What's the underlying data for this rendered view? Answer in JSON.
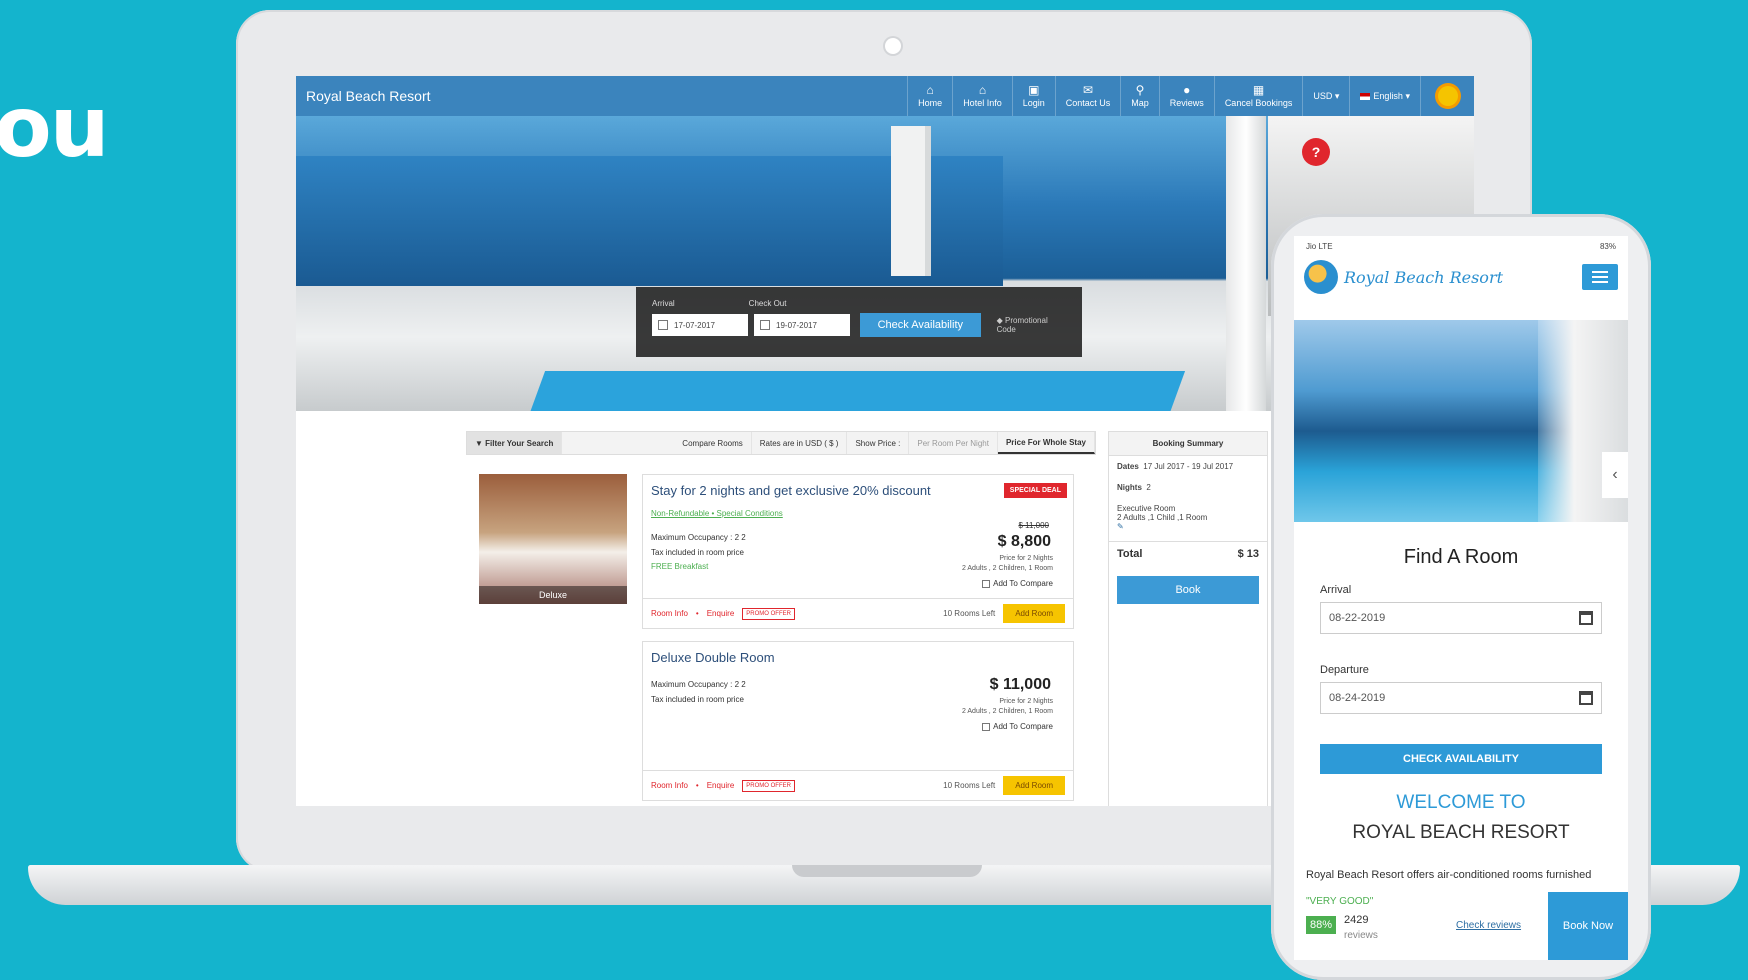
{
  "headline": "ou",
  "desktop": {
    "brand": "Royal Beach Resort",
    "nav": [
      {
        "icon": "home-icon",
        "glyph": "⌂",
        "label": "Home"
      },
      {
        "icon": "hotel-info-icon",
        "glyph": "⌂",
        "label": "Hotel Info"
      },
      {
        "icon": "lock-icon",
        "glyph": "🔒",
        "label": "Login"
      },
      {
        "icon": "envelope-icon",
        "glyph": "✉",
        "label": "Contact Us"
      },
      {
        "icon": "map-pin-icon",
        "glyph": "⚲",
        "label": "Map"
      },
      {
        "icon": "chat-icon",
        "glyph": "💬",
        "label": "Reviews"
      },
      {
        "icon": "calendar-icon",
        "glyph": "▦",
        "label": "Cancel Bookings"
      }
    ],
    "currency": "USD",
    "language": "English",
    "help": "?",
    "search": {
      "arrival_label": "Arrival",
      "checkout_label": "Check Out",
      "arrival": "17-07-2017",
      "checkout": "19-07-2017",
      "button": "Check Availability",
      "promo": "Promotional Code"
    },
    "filters": {
      "filter": "Filter Your Search",
      "compare": "Compare Rooms",
      "rates": "Rates are in USD ( $ )",
      "show_price": "Show Price :",
      "per_night": "Per Room Per Night",
      "whole_stay": "Price For Whole Stay"
    },
    "room_image_label": "Deluxe",
    "rooms": [
      {
        "title": "Stay for 2 nights and get exclusive 20% discount",
        "badge": "SPECIAL DEAL",
        "links": "Non-Refundable  •  Special Conditions",
        "occupancy": "Maximum Occupancy :  2  2",
        "tax": "Tax included in room price",
        "extra": "FREE Breakfast",
        "old_price": "$ 11,000",
        "price": "$ 8,800",
        "price_note": "Price for 2 Nights",
        "guests": "2 Adults , 2 Children, 1 Room",
        "compare": "Add To Compare",
        "room_info": "Room Info",
        "enquire": "Enquire",
        "promo": "PROMO OFFER",
        "rooms_left": "10 Rooms Left",
        "add": "Add Room"
      },
      {
        "title": "Deluxe Double Room",
        "occupancy": "Maximum Occupancy :  2  2",
        "tax": "Tax included in room price",
        "price": "$ 11,000",
        "price_note": "Price for 2 Nights",
        "guests": "2 Adults , 2 Children, 1 Room",
        "compare": "Add To Compare",
        "room_info": "Room Info",
        "enquire": "Enquire",
        "promo": "PROMO OFFER",
        "rooms_left": "10 Rooms Left",
        "add": "Add Room"
      }
    ],
    "summary": {
      "title": "Booking Summary",
      "dates_label": "Dates",
      "dates": "17 Jul 2017 - 19 Jul 2017",
      "nights_label": "Nights",
      "nights": "2",
      "room": "Executive Room",
      "room_detail": "2 Adults ,1 Child ,1 Room",
      "total_label": "Total",
      "total": "$ 13",
      "book": "Book"
    }
  },
  "mobile": {
    "status_left": "Jio  LTE",
    "status_right": "83%",
    "logo": "Royal Beach Resort",
    "find": "Find A Room",
    "arrival_label": "Arrival",
    "arrival": "08-22-2019",
    "departure_label": "Departure",
    "departure": "08-24-2019",
    "check": "CHECK AVAILABILITY",
    "welcome": "WELCOME TO",
    "resort": "ROYAL BEACH RESORT",
    "desc": "Royal Beach Resort offers air-conditioned rooms furnished",
    "rating_text": "\"VERY GOOD\"",
    "rating_pct": "88%",
    "reviews_count": "2429",
    "reviews_label": "reviews",
    "check_reviews": "Check reviews",
    "book_now": "Book Now"
  },
  "colors": {
    "background": "#14b4cd",
    "primary": "#3c9ad6",
    "accent_red": "#e0262d",
    "add_room": "#f6c400"
  }
}
